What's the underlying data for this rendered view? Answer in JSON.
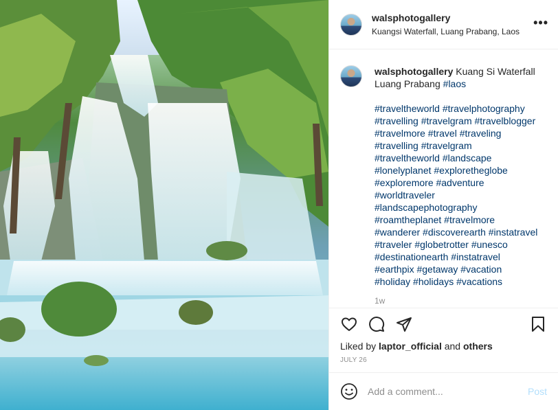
{
  "post": {
    "username": "walsphotogallery",
    "location": "Kuangsi Waterfall, Luang Prabang, Laos",
    "more_icon": "more-horizontal-icon",
    "caption": {
      "username": "walsphotogallery",
      "text": "Kuang Si Waterfall Luang Prabang",
      "tag": "#laos",
      "hashtag_lines": [
        "#traveltheworld #travelphotography",
        "#travelling #travelgram #travelblogger",
        "#travelmore #travel #traveling",
        "#travelling #travelgram",
        "#traveltheworld #landscape",
        "#lonelyplanet #exploretheglobe",
        "#exploremore #adventure",
        "#worldtraveler",
        "#landscapephotography",
        "#roamtheplanet #travelmore",
        "#wanderer #discoverearth #instatravel",
        "#traveler #globetrotter #unesco",
        "#destinationearth #instatravel",
        "#earthpix #getaway #vacation",
        "#holiday #holidays #vacations"
      ],
      "time_ago": "1w"
    },
    "likes": {
      "prefix": "Liked by",
      "user": "laptor_official",
      "joiner": "and",
      "others": "others"
    },
    "date": "JULY 26",
    "comment": {
      "placeholder": "Add a comment...",
      "post_label": "Post"
    },
    "icons": [
      "heart-icon",
      "comment-icon",
      "share-icon",
      "bookmark-icon",
      "emoji-icon"
    ],
    "colors": {
      "link": "#00376b",
      "muted": "#8e8e8e",
      "post_button": "#b2dffc",
      "border": "#efefef"
    }
  }
}
